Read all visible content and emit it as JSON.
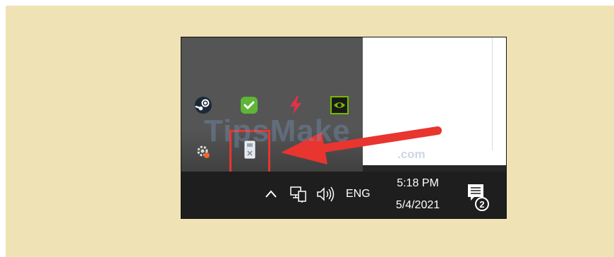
{
  "page": {
    "background": "#efe3b5"
  },
  "overflow_tray": {
    "icons": [
      "steam-icon",
      "security-check-icon",
      "lightning-icon",
      "nvidia-icon",
      "gear-icon",
      "safely-remove-usb-icon"
    ]
  },
  "annotation": {
    "highlight_color": "#e8352f",
    "arrow_color": "#e8352f"
  },
  "watermark": {
    "text": "TipsMake",
    "suffix": ".com"
  },
  "taskbar": {
    "language": "ENG",
    "time": "5:18 PM",
    "date": "5/4/2021",
    "notification_count": "2"
  }
}
